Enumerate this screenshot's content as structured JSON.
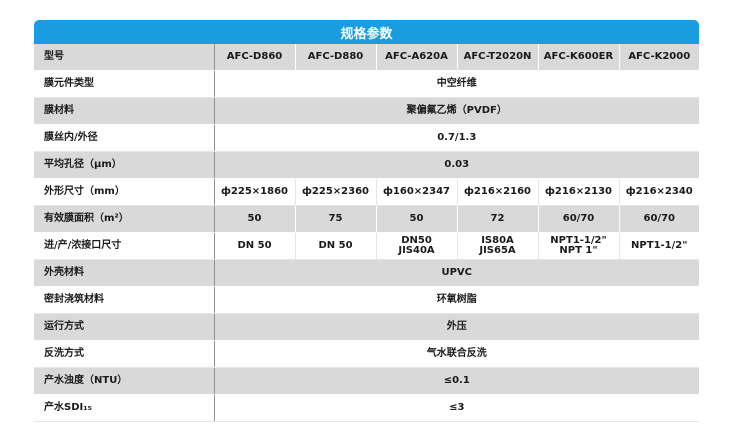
{
  "header": {
    "title": "规格参数",
    "title_bar_color": "#1a9de0"
  },
  "model_row": {
    "label": "型号",
    "models": [
      "AFC-D860",
      "AFC-D880",
      "AFC-A620A",
      "AFC-T2020N",
      "AFC-K600ER",
      "AFC-K2000"
    ]
  },
  "rows": {
    "element_type": {
      "label": "膜元件类型",
      "value": "中空纤维"
    },
    "material": {
      "label": "膜材料",
      "value": "聚偏氟乙烯（PVDF）"
    },
    "fiber_diameter": {
      "label": "膜丝内/外径",
      "value": "0.7/1.3"
    },
    "pore_size": {
      "label": "平均孔径（μm）",
      "value": "0.03"
    },
    "dimensions": {
      "label": "外形尺寸（mm）",
      "values": [
        "ф225×1860",
        "ф225×2360",
        "ф160×2347",
        "ф216×2160",
        "ф216×2130",
        "ф216×2340"
      ]
    },
    "area": {
      "label": "有效膜面积（m²）",
      "values": [
        "50",
        "75",
        "50",
        "72",
        "60/70",
        "60/70"
      ]
    },
    "connection": {
      "label": "进/产/浓接口尺寸",
      "values": [
        [
          "DN 50"
        ],
        [
          "DN 50"
        ],
        [
          "DN50",
          "JIS40A"
        ],
        [
          "IS80A",
          "JIS65A"
        ],
        [
          "NPT1-1/2\"",
          "NPT 1\""
        ],
        [
          "NPT1-1/2\""
        ]
      ]
    },
    "housing": {
      "label": "外壳材料",
      "value": "UPVC"
    },
    "potting": {
      "label": "密封浇筑材料",
      "value": "环氧树脂"
    },
    "operation": {
      "label": "运行方式",
      "value": "外压"
    },
    "backwash": {
      "label": "反洗方式",
      "value": "气水联合反洗"
    },
    "turbidity": {
      "label": "产水浊度（NTU）",
      "value": "≤0.1"
    },
    "sdi": {
      "label": "产水SDI₁₅",
      "value": "≤3"
    }
  }
}
